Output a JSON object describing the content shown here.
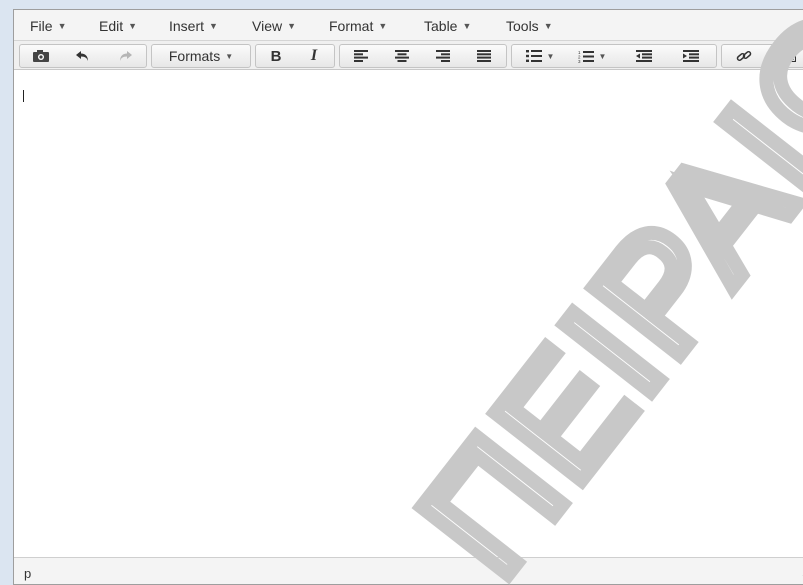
{
  "menubar": {
    "items": [
      {
        "label": "File"
      },
      {
        "label": "Edit"
      },
      {
        "label": "Insert"
      },
      {
        "label": "View"
      },
      {
        "label": "Format"
      },
      {
        "label": "Table"
      },
      {
        "label": "Tools"
      }
    ]
  },
  "toolbar": {
    "formats_label": "Formats",
    "bold_label": "B",
    "italic_label": "I",
    "icons": [
      "preview-icon",
      "undo-icon",
      "redo-icon",
      "align-left-icon",
      "align-center-icon",
      "align-right-icon",
      "align-justify-icon",
      "bullet-list-icon",
      "numbered-list-icon",
      "outdent-icon",
      "indent-icon",
      "link-icon",
      "image-icon"
    ]
  },
  "content": {
    "text": "|"
  },
  "statusbar": {
    "path": "p"
  },
  "watermark": {
    "text": "ΠΕΙΡΑΙΩΣ"
  },
  "colors": {
    "page_background": "#dbe5f1",
    "watermark": "#c8c8c8"
  }
}
